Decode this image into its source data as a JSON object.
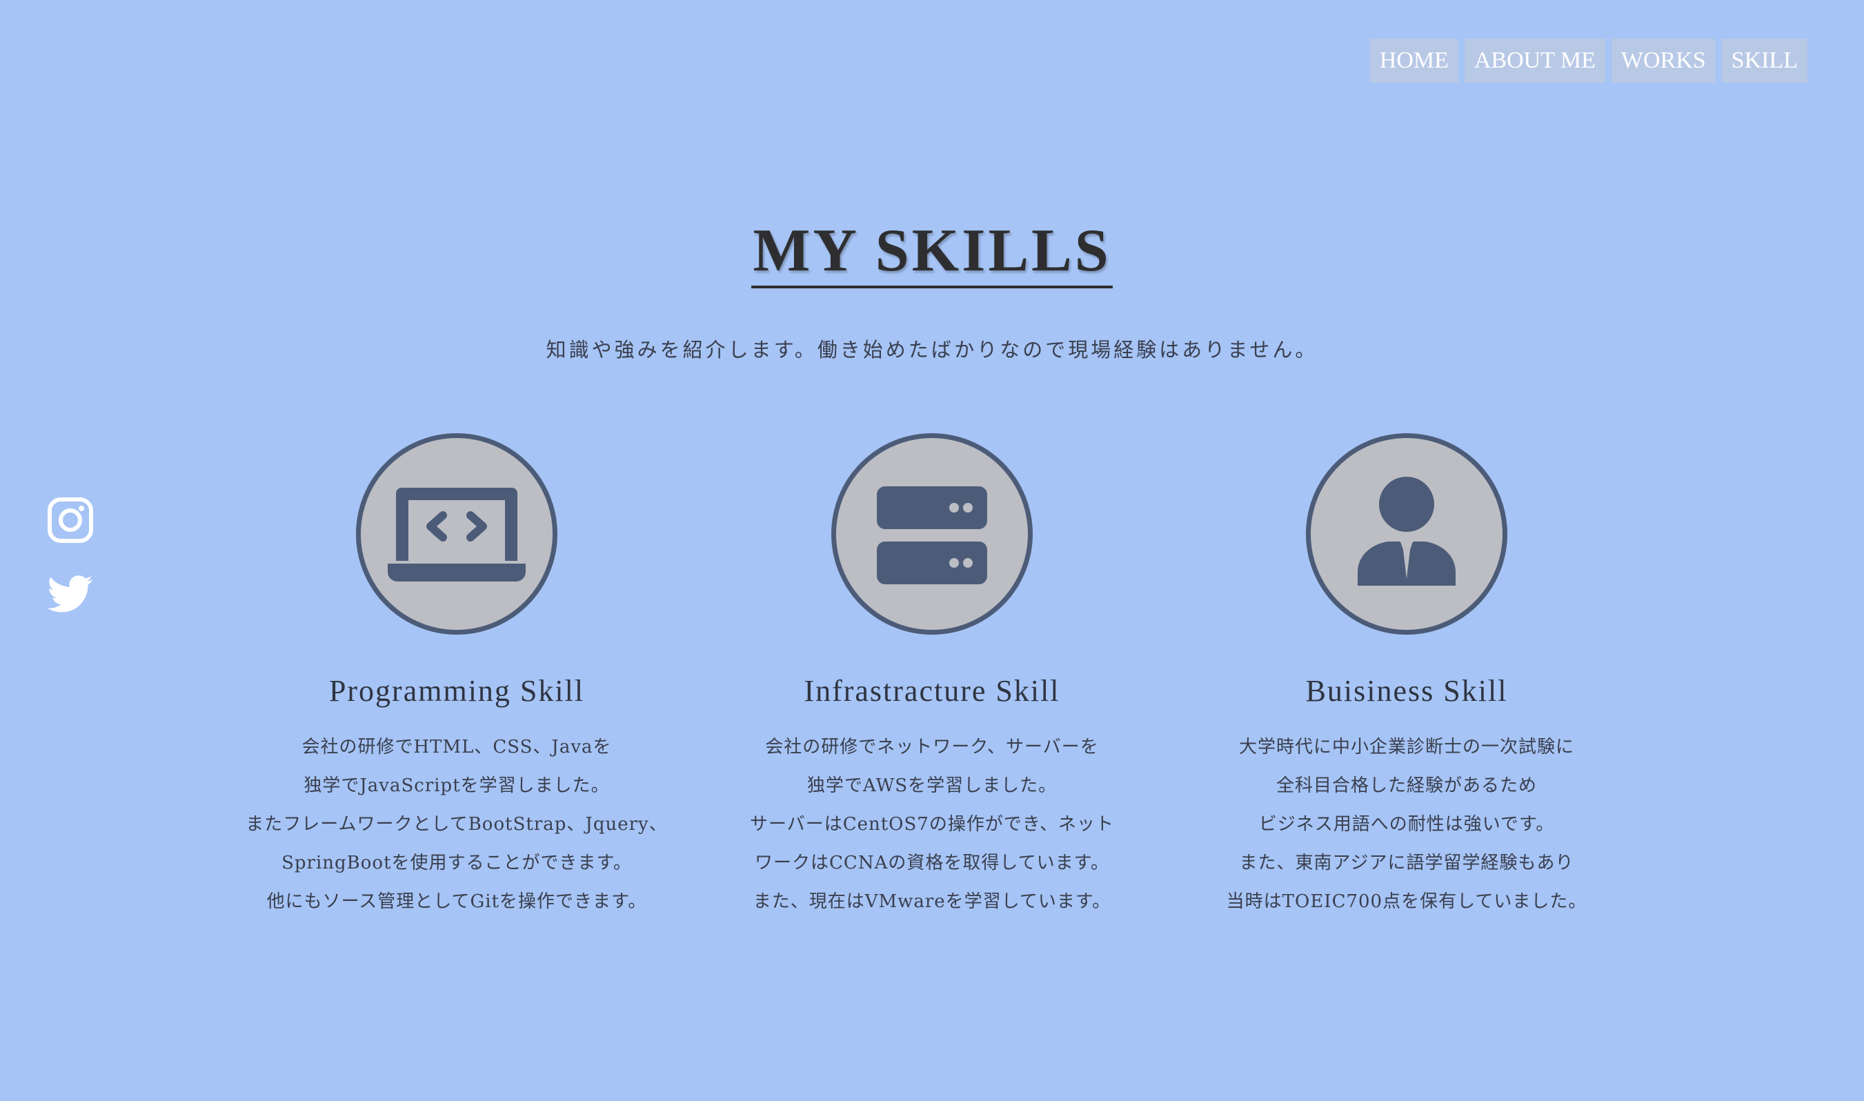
{
  "nav": {
    "items": [
      {
        "label": "HOME"
      },
      {
        "label": "ABOUT ME"
      },
      {
        "label": "WORKS"
      },
      {
        "label": "SKILL"
      }
    ]
  },
  "social": {
    "icons": [
      "instagram-icon",
      "twitter-icon"
    ]
  },
  "header": {
    "title": "MY SKILLS",
    "subtitle": "知識や強みを紹介します。働き始めたばかりなので現場経験はありません。"
  },
  "skills": [
    {
      "icon": "laptop-code-icon",
      "title": "Programming Skill",
      "lines": [
        "会社の研修でHTML、CSS、Javaを",
        "独学でJavaScriptを学習しました。",
        "またフレームワークとしてBootStrap、Jquery、",
        "SpringBootを使用することができます。",
        "他にもソース管理としてGitを操作できます。"
      ]
    },
    {
      "icon": "server-icon",
      "title": "Infrastracture Skill",
      "lines": [
        "会社の研修でネットワーク、サーバーを",
        "独学でAWSを学習しました。",
        "サーバーはCentOS7の操作ができ、ネット",
        "ワークはCCNAの資格を取得しています。",
        "また、現在はVMwareを学習しています。"
      ]
    },
    {
      "icon": "businessman-icon",
      "title": "Buisiness Skill",
      "lines": [
        "大学時代に中小企業診断士の一次試験に",
        "全科目合格した経験があるため",
        "ビジネス用語への耐性は強いです。",
        "また、東南アジアに語学留学経験もあり",
        "当時はTOEIC700点を保有していました。"
      ]
    }
  ],
  "colors": {
    "background": "#a6c4f5",
    "nav_bg": "#b8c9e6",
    "icon_fill": "#4c5c78",
    "icon_circle": "#bcbec4"
  }
}
